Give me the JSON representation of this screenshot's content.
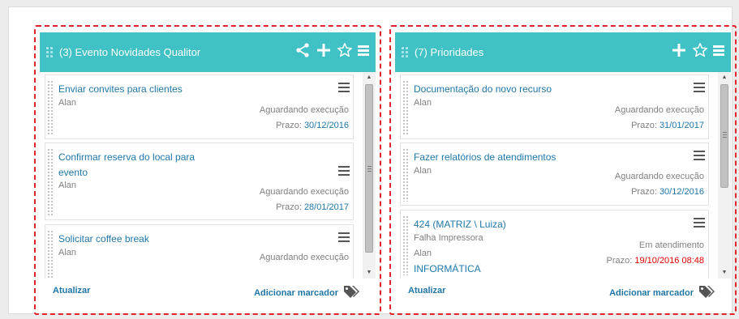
{
  "colors": {
    "header": "#3fc1c5",
    "link": "#1f77a8",
    "overdue": "#e00000",
    "highlight_border": "#e0242b"
  },
  "widgets": [
    {
      "count": "(3)",
      "title": "Evento Novidades Qualitor",
      "header_icons": [
        "share-icon",
        "plus-icon",
        "star-icon",
        "menu-icon"
      ],
      "cards": [
        {
          "title": "Enviar convites para clientes",
          "user": "Alan",
          "status": "Aguardando execução",
          "due_label": "Prazo:",
          "due_date": "30/12/2016"
        },
        {
          "title": "Confirmar reserva do local para evento",
          "user": "Alan",
          "status": "Aguardando execução",
          "due_label": "Prazo:",
          "due_date": "28/01/2017"
        },
        {
          "title": "Solicitar coffee break",
          "user": "Alan",
          "status": "Aguardando execução"
        }
      ],
      "scroll": {
        "position": 0.0
      },
      "footer": {
        "refresh_label": "Atualizar",
        "add_label": "Adicionar marcador"
      }
    },
    {
      "count": "(7)",
      "title": "Prioridades",
      "header_icons": [
        "plus-icon",
        "star-icon",
        "menu-icon"
      ],
      "cards": [
        {
          "title": "Documentação do novo recurso",
          "user": "Alan",
          "status": "Aguardando execução",
          "due_label": "Prazo:",
          "due_date": "31/01/2017"
        },
        {
          "title": "Fazer relatórios de atendimentos",
          "user": "Alan",
          "status": "Aguardando execução",
          "due_label": "Prazo:",
          "due_date": "30/12/2016"
        },
        {
          "title": "424 (MATRIZ \\ Luiza)",
          "extra": "Falha Impressora",
          "user": "Alan",
          "department": "INFORMÁTICA",
          "status": "Em atendimento",
          "due_label": "Prazo:",
          "due_date": "19/10/2016 08:48",
          "overdue": true
        }
      ],
      "scroll": {
        "position": 0.0
      },
      "footer": {
        "refresh_label": "Atualizar",
        "add_label": "Adicionar marcador"
      }
    }
  ]
}
